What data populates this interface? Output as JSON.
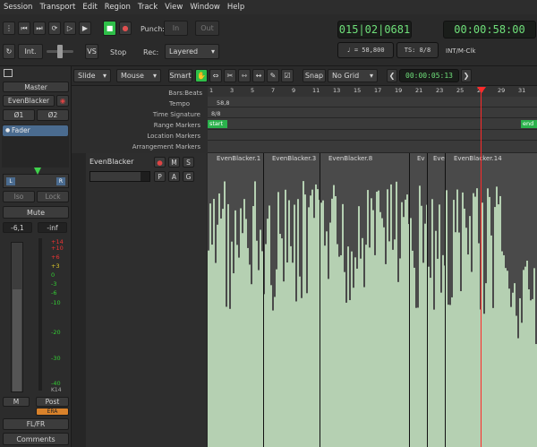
{
  "menu": [
    "Session",
    "Transport",
    "Edit",
    "Region",
    "Track",
    "View",
    "Window",
    "Help"
  ],
  "transport": {
    "punch": "Punch:",
    "in": "In",
    "out": "Out",
    "int": "Int.",
    "vs": "VS",
    "stop": "Stop",
    "rec": "Rec:",
    "rec_mode": "Layered",
    "bbt": "015|02|0681",
    "tempo": "♩ = 58,800",
    "ts": "TS: 8/8",
    "timecode": "00:00:58:00",
    "sync": "INT/M-Clk"
  },
  "edit": {
    "mode": "Slide",
    "tool": "Mouse",
    "smart": "Smart",
    "snap": "Snap",
    "grid": "No Grid",
    "nudge": "00:00:05:13"
  },
  "rulers": {
    "labels": [
      "Bars:Beats",
      "Tempo",
      "Time Signature",
      "Range Markers",
      "Location Markers",
      "Arrangement Markers"
    ],
    "tempo_val": "58,8",
    "ts_val": "8/8",
    "start": "start",
    "end": "end",
    "bars": [
      "1",
      "3",
      "5",
      "7",
      "9",
      "11",
      "13",
      "15",
      "17",
      "19",
      "21",
      "23",
      "25",
      "27",
      "29",
      "31"
    ]
  },
  "mixer": {
    "master": "Master",
    "track": "EvenBlacker",
    "o1": "Ø1",
    "o2": "Ø2",
    "fader": "Fader",
    "l": "L",
    "r": "R",
    "iso": "Iso",
    "lock": "Lock",
    "mute": "Mute",
    "gain": "-6,1",
    "peak": "-inf",
    "scale": [
      "+14",
      "+10",
      "+6",
      "+3",
      "0",
      "-3",
      "-6",
      "-10",
      "-20",
      "-30",
      "-40"
    ],
    "k14": "K14",
    "m": "M",
    "post": "Post",
    "extra": "ERA",
    "flfr": "FL/FR",
    "comments": "Comments"
  },
  "track": {
    "name": "EvenBlacker",
    "m": "M",
    "s": "S",
    "p": "P",
    "a": "A",
    "g": "G"
  },
  "regions": [
    "EvenBlacker.1",
    "EvenBlacker.3",
    "EvenBlacker.8",
    "Ev",
    "Eve",
    "EvenBlacker.14"
  ],
  "colors": {
    "accent": "#2fbf49",
    "lcd": "#6fe07a",
    "wave": "#b5d0b2",
    "playhead": "#ff2a2a"
  }
}
